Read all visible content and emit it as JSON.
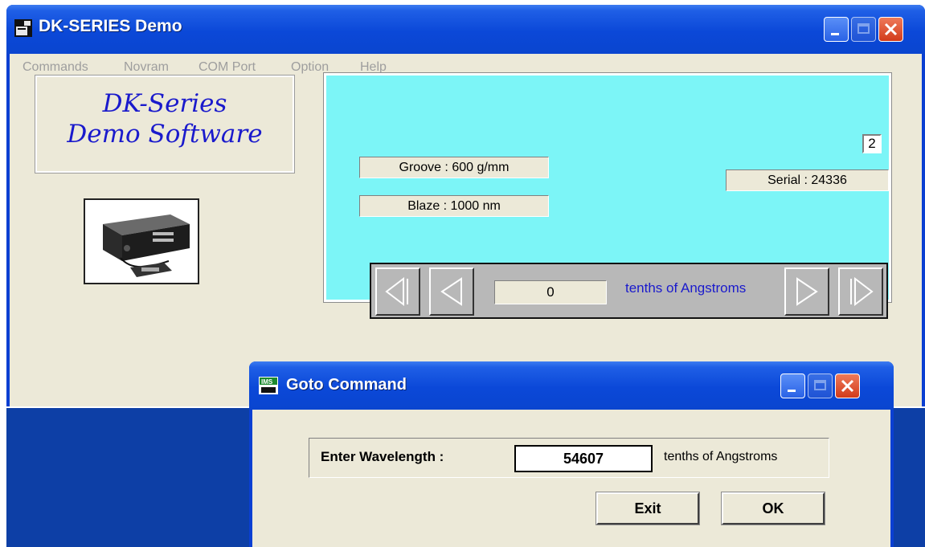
{
  "main_window": {
    "title": "DK-SERIES Demo",
    "menu": [
      "Commands",
      "Novram",
      "COM Port",
      "Option",
      "Help"
    ]
  },
  "logo": {
    "line1": "DK-Series",
    "line2": "Demo Software"
  },
  "info": {
    "groove": "Groove : 600 g/mm",
    "blaze": "Blaze : 1000 nm",
    "serial": "Serial : 24336",
    "counter": "2"
  },
  "stepper": {
    "value": "0",
    "unit": "tenths of Angstroms"
  },
  "dialog": {
    "title": "Goto Command",
    "label": "Enter Wavelength :",
    "value": "54607",
    "unit": "tenths of Angstroms",
    "exit_label": "Exit",
    "ok_label": "OK"
  },
  "colors": {
    "panel": "#7cf5f7",
    "titlebar": "#0a45cf",
    "logo_text": "#1a1acc"
  }
}
